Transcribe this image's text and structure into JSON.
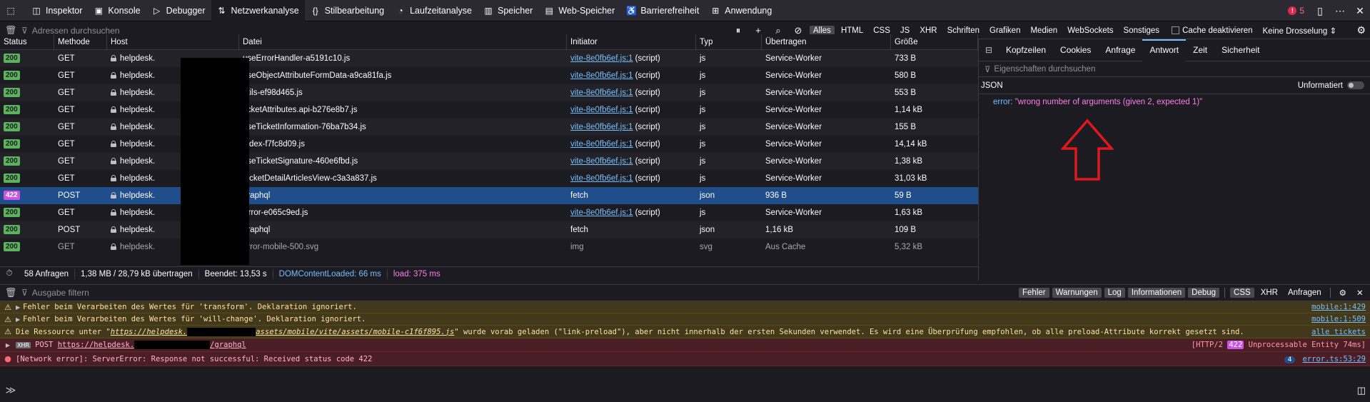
{
  "toolbar": {
    "tabs": [
      {
        "label": "Inspektor",
        "icon": "inspector-icon"
      },
      {
        "label": "Konsole",
        "icon": "console-icon"
      },
      {
        "label": "Debugger",
        "icon": "debugger-icon"
      },
      {
        "label": "Netzwerkanalyse",
        "icon": "network-icon"
      },
      {
        "label": "Stilbearbeitung",
        "icon": "style-editor-icon"
      },
      {
        "label": "Laufzeitanalyse",
        "icon": "performance-icon"
      },
      {
        "label": "Speicher",
        "icon": "memory-icon"
      },
      {
        "label": "Web-Speicher",
        "icon": "storage-icon"
      },
      {
        "label": "Barrierefreiheit",
        "icon": "accessibility-icon"
      },
      {
        "label": "Anwendung",
        "icon": "application-icon"
      }
    ],
    "error_count": "5"
  },
  "network": {
    "filter_placeholder": "Adressen durchsuchen",
    "type_filters": [
      "Alles",
      "HTML",
      "CSS",
      "JS",
      "XHR",
      "Schriften",
      "Grafiken",
      "Medien",
      "WebSockets",
      "Sonstiges"
    ],
    "cache_label": "Cache deaktivieren",
    "throttle_label": "Keine Drosselung ⇕",
    "columns": [
      "Status",
      "Methode",
      "Host",
      "Datei",
      "Initiator",
      "Typ",
      "Übertragen",
      "Größe"
    ],
    "rows": [
      {
        "status": "200",
        "method": "GET",
        "host": "helpdesk.",
        "file": "useErrorHandler-a5191c10.js",
        "initiator": "vite-8e0fb6ef.js:1",
        "initiator_suffix": "(script)",
        "type": "js",
        "transferred": "Service-Worker",
        "size": "733 B"
      },
      {
        "status": "200",
        "method": "GET",
        "host": "helpdesk.",
        "file": "useObjectAttributeFormData-a9ca81fa.js",
        "initiator": "vite-8e0fb6ef.js:1",
        "initiator_suffix": "(script)",
        "type": "js",
        "transferred": "Service-Worker",
        "size": "580 B"
      },
      {
        "status": "200",
        "method": "GET",
        "host": "helpdesk.",
        "file": "utils-ef98d465.js",
        "initiator": "vite-8e0fb6ef.js:1",
        "initiator_suffix": "(script)",
        "type": "js",
        "transferred": "Service-Worker",
        "size": "553 B"
      },
      {
        "status": "200",
        "method": "GET",
        "host": "helpdesk.",
        "file": "ticketAttributes.api-b276e8b7.js",
        "initiator": "vite-8e0fb6ef.js:1",
        "initiator_suffix": "(script)",
        "type": "js",
        "transferred": "Service-Worker",
        "size": "1,14 kB"
      },
      {
        "status": "200",
        "method": "GET",
        "host": "helpdesk.",
        "file": "useTicketInformation-76ba7b34.js",
        "initiator": "vite-8e0fb6ef.js:1",
        "initiator_suffix": "(script)",
        "type": "js",
        "transferred": "Service-Worker",
        "size": "155 B"
      },
      {
        "status": "200",
        "method": "GET",
        "host": "helpdesk.",
        "file": "index-f7fc8d09.js",
        "initiator": "vite-8e0fb6ef.js:1",
        "initiator_suffix": "(script)",
        "type": "js",
        "transferred": "Service-Worker",
        "size": "14,14 kB"
      },
      {
        "status": "200",
        "method": "GET",
        "host": "helpdesk.",
        "file": "useTicketSignature-460e6fbd.js",
        "initiator": "vite-8e0fb6ef.js:1",
        "initiator_suffix": "(script)",
        "type": "js",
        "transferred": "Service-Worker",
        "size": "1,38 kB"
      },
      {
        "status": "200",
        "method": "GET",
        "host": "helpdesk.",
        "file": "TicketDetailArticlesView-c3a3a837.js",
        "initiator": "vite-8e0fb6ef.js:1",
        "initiator_suffix": "(script)",
        "type": "js",
        "transferred": "Service-Worker",
        "size": "31,03 kB"
      },
      {
        "status": "422",
        "method": "POST",
        "host": "helpdesk.",
        "file": "graphql",
        "initiator": "fetch",
        "initiator_suffix": "",
        "type": "json",
        "transferred": "936 B",
        "size": "59 B"
      },
      {
        "status": "200",
        "method": "GET",
        "host": "helpdesk.",
        "file": "Error-e065c9ed.js",
        "initiator": "vite-8e0fb6ef.js:1",
        "initiator_suffix": "(script)",
        "type": "js",
        "transferred": "Service-Worker",
        "size": "1,63 kB"
      },
      {
        "status": "200",
        "method": "POST",
        "host": "helpdesk.",
        "file": "graphql",
        "initiator": "fetch",
        "initiator_suffix": "",
        "type": "json",
        "transferred": "1,16 kB",
        "size": "109 B"
      },
      {
        "status": "200",
        "method": "GET",
        "host": "helpdesk.",
        "file": "error-mobile-500.svg",
        "initiator": "img",
        "initiator_suffix": "",
        "type": "svg",
        "transferred": "Aus Cache",
        "size": "5,32 kB"
      }
    ],
    "summary": {
      "requests": "58 Anfragen",
      "transferred": "1,38 MB / 28,79 kB übertragen",
      "finished": "Beendet: 13,53 s",
      "dom": "DOMContentLoaded: 66 ms",
      "load": "load: 375 ms"
    }
  },
  "details": {
    "tabs": [
      "Kopfzeilen",
      "Cookies",
      "Anfrage",
      "Antwort",
      "Zeit",
      "Sicherheit"
    ],
    "active_tab": "Antwort",
    "filter_placeholder": "Eigenschaften durchsuchen",
    "section": "JSON",
    "raw_label": "Unformatiert",
    "json_key": "error:",
    "json_value": "\"wrong number of arguments (given 2, expected 1)\""
  },
  "console": {
    "filter_placeholder": "Ausgabe filtern",
    "levels": [
      "Fehler",
      "Warnungen",
      "Log",
      "Informationen",
      "Debug"
    ],
    "extras": [
      "CSS",
      "XHR",
      "Anfragen"
    ],
    "messages": [
      {
        "text": "Fehler beim Verarbeiten des Wertes für 'transform'.  Deklaration ignoriert.",
        "source": "mobile:1:429"
      },
      {
        "text": "Fehler beim Verarbeiten des Wertes für 'will-change'.  Deklaration ignoriert.",
        "source": "mobile:1:509"
      },
      {
        "text_before": "Die Ressource unter \"",
        "link1": "https://helpdesk.",
        "link2": "assets/mobile/vite/assets/mobile-c1f6f895.js",
        "text_after": "\" wurde vorab geladen (\"link-preload\"), aber nicht innerhalb der ersten Sekunden verwendet. Es wird eine Überprüfung empfohlen, ob alle preload-Attribute korrekt gesetzt sind.",
        "source": "alle tickets"
      },
      {
        "xhr": "XHR",
        "method": "POST",
        "link1": "https://helpdesk.",
        "link2": "/graphql",
        "http_prefix": "[HTTP/2 ",
        "http_status": "422",
        "http_suffix": " Unprocessable Entity 74ms]"
      },
      {
        "text": "[Network error]: ServerError: Response not successful: Received status code 422",
        "count": "4",
        "source": "error.ts:53:29"
      }
    ]
  }
}
